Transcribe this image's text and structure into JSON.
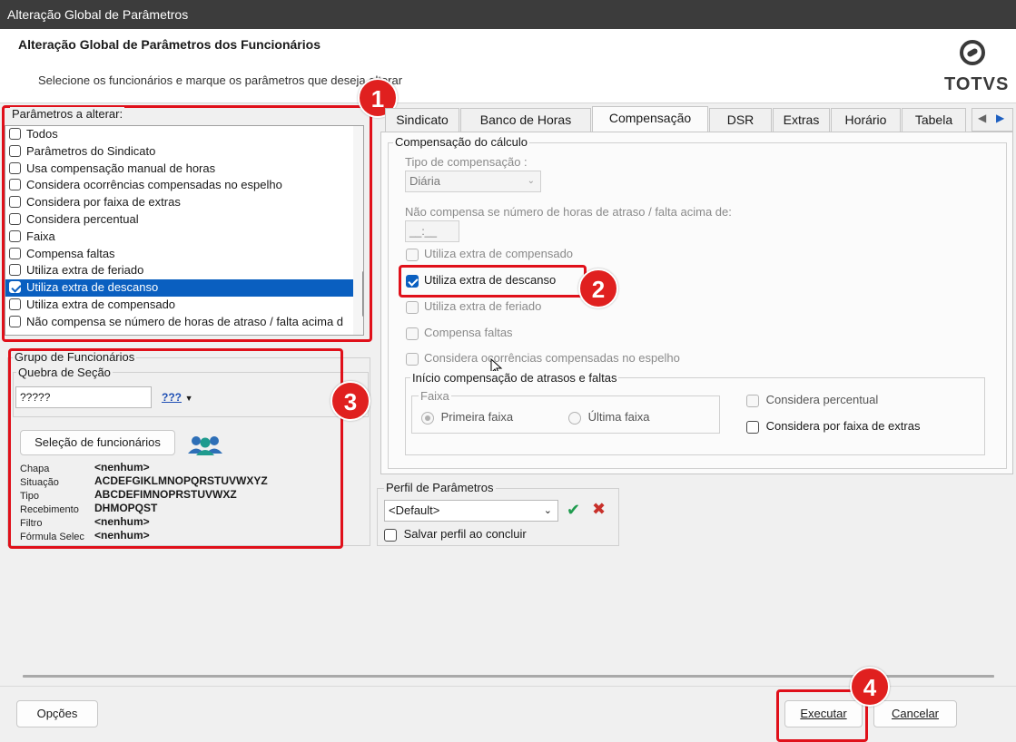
{
  "window": {
    "title": "Alteração Global de Parâmetros"
  },
  "header": {
    "title": "Alteração Global de Parâmetros dos Funcionários",
    "subtitle": "Selecione os funcionários e marque os parâmetros que deseja alterar",
    "logo_text": "TOTVS"
  },
  "params": {
    "group_label": "Parâmetros a alterar:",
    "items": [
      {
        "label": "Todos",
        "checked": false
      },
      {
        "label": "Parâmetros do Sindicato",
        "checked": false
      },
      {
        "label": "Usa compensação manual de horas",
        "checked": false
      },
      {
        "label": "Considera ocorrências compensadas no espelho",
        "checked": false
      },
      {
        "label": "Considera por faixa de extras",
        "checked": false
      },
      {
        "label": "Considera percentual",
        "checked": false
      },
      {
        "label": "Faixa",
        "checked": false
      },
      {
        "label": "Compensa faltas",
        "checked": false
      },
      {
        "label": "Utiliza extra de feriado",
        "checked": false
      },
      {
        "label": "Utiliza extra de descanso",
        "checked": true,
        "selected": true
      },
      {
        "label": "Utiliza extra de compensado",
        "checked": false
      },
      {
        "label": "Não compensa se número de horas de atraso / falta acima d",
        "checked": false
      }
    ]
  },
  "grupo": {
    "group_label": "Grupo de Funcionários",
    "quebra_label": "Quebra de Seção",
    "quebra_value": "?????",
    "picker_icon_text": "???",
    "selecao_button": "Seleção de funcionários",
    "info": [
      {
        "label": "Chapa",
        "value": "<nenhum>"
      },
      {
        "label": "Situação",
        "value": "ACDEFGIKLMNOPQRSTUVWXYZ"
      },
      {
        "label": "Tipo",
        "value": "ABCDEFIMNOPRSTUVWXZ"
      },
      {
        "label": "Recebimento",
        "value": "DHMOPQST"
      },
      {
        "label": "Filtro",
        "value": "<nenhum>"
      },
      {
        "label": "Fórmula Selec",
        "value": "<nenhum>"
      }
    ]
  },
  "tabs": [
    "Sindicato",
    "Banco de Horas",
    "Compensação",
    "DSR",
    "Extras",
    "Horário",
    "Tabela"
  ],
  "active_tab": "Compensação",
  "compensacao": {
    "group_label": "Compensação do cálculo",
    "tipo_label": "Tipo de compensação :",
    "tipo_value": "Diária",
    "nao_compensa_label": "Não compensa se número de horas de atraso / falta acima de:",
    "nao_compensa_value": "__:__",
    "checks": [
      {
        "label": "Utiliza extra de compensado",
        "checked": false,
        "enabled": false
      },
      {
        "label": "Utiliza extra de descanso",
        "checked": true,
        "enabled": true
      },
      {
        "label": "Utiliza extra de feriado",
        "checked": false,
        "enabled": false
      },
      {
        "label": "Compensa faltas",
        "checked": false,
        "enabled": false
      },
      {
        "label": "Considera ocorrências compensadas no espelho",
        "checked": false,
        "enabled": false
      }
    ],
    "inicio_label": "Início compensação de atrasos e faltas",
    "faixa_label": "Faixa",
    "primeira_faixa": "Primeira faixa",
    "ultima_faixa": "Última faixa",
    "considera_percentual": "Considera percentual",
    "considera_faixa_extras": "Considera por faixa de extras"
  },
  "perfil": {
    "group_label": "Perfil de Parâmetros",
    "value": "<Default>",
    "salvar_label": "Salvar perfil ao concluir"
  },
  "footer": {
    "opcoes": "Opções",
    "executar": "Executar",
    "cancelar": "Cancelar"
  },
  "annotations": {
    "b1": "1",
    "b2": "2",
    "b3": "3",
    "b4": "4"
  },
  "colors": {
    "highlight": "#0a5fc0",
    "annotation_red": "#e0101a",
    "titlebar": "#3c3c3c"
  }
}
